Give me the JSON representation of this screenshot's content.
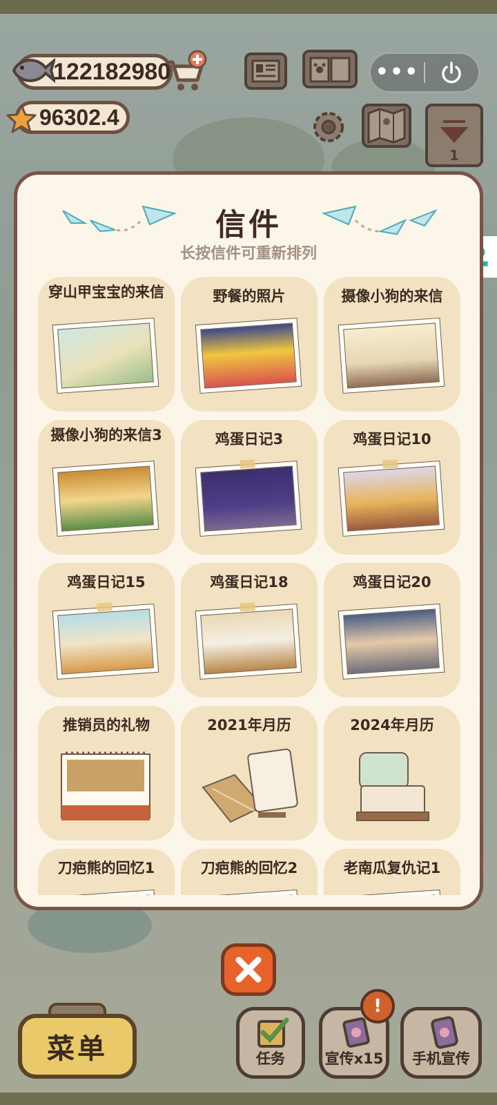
{
  "currency": {
    "fish_amount": "122182980",
    "star_amount": "96302.4"
  },
  "system": {
    "more_icon": "more-dots-icon",
    "power_icon": "power-icon"
  },
  "letters_modal": {
    "title": "信件",
    "subtitle": "长按信件可重新排列",
    "letters": [
      {
        "title": "穿山甲宝宝的来信"
      },
      {
        "title": "野餐的照片"
      },
      {
        "title": "摄像小狗的来信"
      },
      {
        "title": "摄像小狗的来信3"
      },
      {
        "title": "鸡蛋日记3"
      },
      {
        "title": "鸡蛋日记10"
      },
      {
        "title": "鸡蛋日记15"
      },
      {
        "title": "鸡蛋日记18"
      },
      {
        "title": "鸡蛋日记20"
      },
      {
        "title": "推销员的礼物"
      },
      {
        "title": "2021年月历"
      },
      {
        "title": "2024年月历"
      },
      {
        "title": "刀疤熊的回忆1"
      },
      {
        "title": "刀疤熊的回忆2"
      },
      {
        "title": "老南瓜复仇记1"
      }
    ]
  },
  "bottom_bar": {
    "menu_label": "菜单",
    "tasks_label": "任务",
    "promote_label": "宣传x15",
    "promote_badge": "!",
    "phone_promote_label": "手机宣传"
  },
  "colors": {
    "modal_bg": "#fbf5ea",
    "card_bg": "#f3e2c2",
    "frame_brown": "#7a5246",
    "close_orange": "#e8632c"
  }
}
